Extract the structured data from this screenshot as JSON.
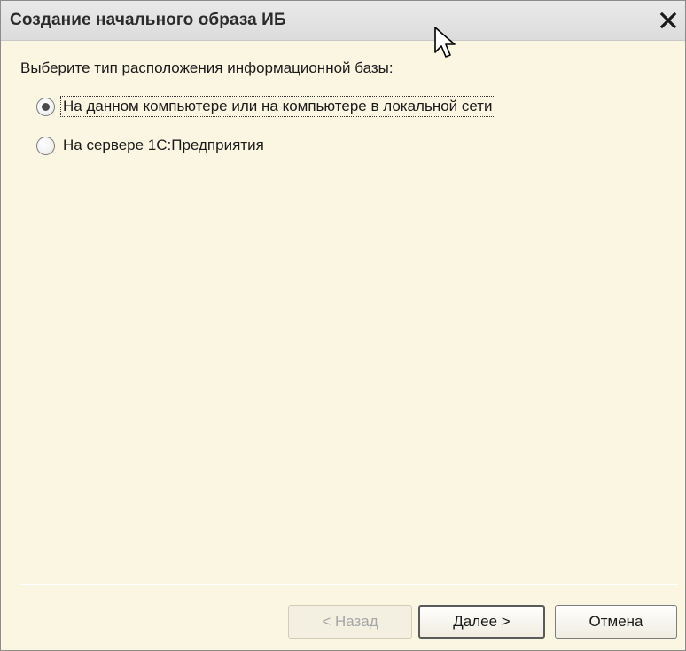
{
  "window": {
    "title": "Создание начального образа ИБ",
    "close_icon": "close-icon"
  },
  "content": {
    "prompt": "Выберите тип расположения информационной базы:",
    "options": [
      {
        "label": "На данном компьютере или на компьютере в локальной сети",
        "selected": true
      },
      {
        "label": "На сервере 1С:Предприятия",
        "selected": false
      }
    ]
  },
  "buttons": {
    "back": "< Назад",
    "next": "Далее >",
    "cancel": "Отмена"
  },
  "colors": {
    "background": "#fbf6e1",
    "titlebar": "#dcdcdc"
  }
}
